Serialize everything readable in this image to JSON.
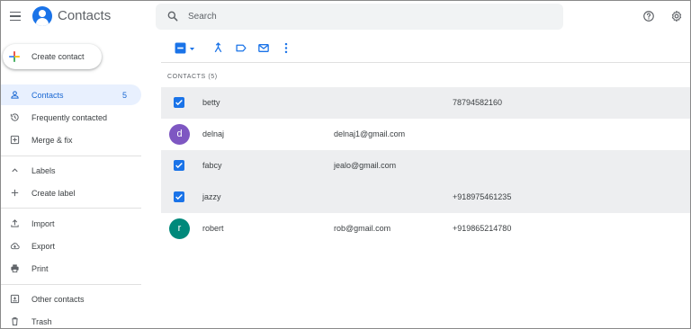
{
  "header": {
    "title": "Contacts",
    "search_placeholder": "Search",
    "icons": [
      "menu-icon",
      "contacts-logo-icon",
      "search-icon",
      "help-icon",
      "settings-icon"
    ]
  },
  "sidebar": {
    "create_label": "Create contact",
    "items": [
      {
        "label": "Contacts",
        "count": "5",
        "icon": "person-icon"
      },
      {
        "label": "Frequently contacted",
        "icon": "history-icon"
      },
      {
        "label": "Merge & fix",
        "icon": "merge-icon"
      },
      {
        "label": "Labels",
        "icon": "chevron-up-icon"
      },
      {
        "label": "Create label",
        "icon": "plus-icon"
      },
      {
        "label": "Import",
        "icon": "upload-icon"
      },
      {
        "label": "Export",
        "icon": "cloud-download-icon"
      },
      {
        "label": "Print",
        "icon": "print-icon"
      },
      {
        "label": "Other contacts",
        "icon": "other-contacts-icon"
      },
      {
        "label": "Trash",
        "icon": "trash-icon"
      }
    ]
  },
  "toolbar": {
    "icons": [
      "select-all-checkbox-icon",
      "dropdown-arrow-icon",
      "merge-icon",
      "label-icon",
      "email-icon",
      "more-vert-icon"
    ]
  },
  "list": {
    "heading": "CONTACTS (5)",
    "rows": [
      {
        "name": "betty",
        "email": "",
        "phone": "78794582160",
        "selected": true,
        "avatar": ""
      },
      {
        "name": "delnaj",
        "email": "delnaj1@gmail.com",
        "phone": "",
        "selected": false,
        "avatar": "d"
      },
      {
        "name": "fabcy",
        "email": "jealo@gmail.com",
        "phone": "",
        "selected": true,
        "avatar": ""
      },
      {
        "name": "jazzy",
        "email": "",
        "phone": "+918975461235",
        "selected": true,
        "avatar": ""
      },
      {
        "name": "robert",
        "email": "rob@gmail.com",
        "phone": "+919865214780",
        "selected": false,
        "avatar": "r"
      }
    ]
  },
  "colors": {
    "accent": "#1a73e8",
    "avatar_d": "#7e57c2",
    "avatar_r": "#00897b",
    "selected_row": "#edeef0",
    "active_nav": "#e8f0fe"
  }
}
